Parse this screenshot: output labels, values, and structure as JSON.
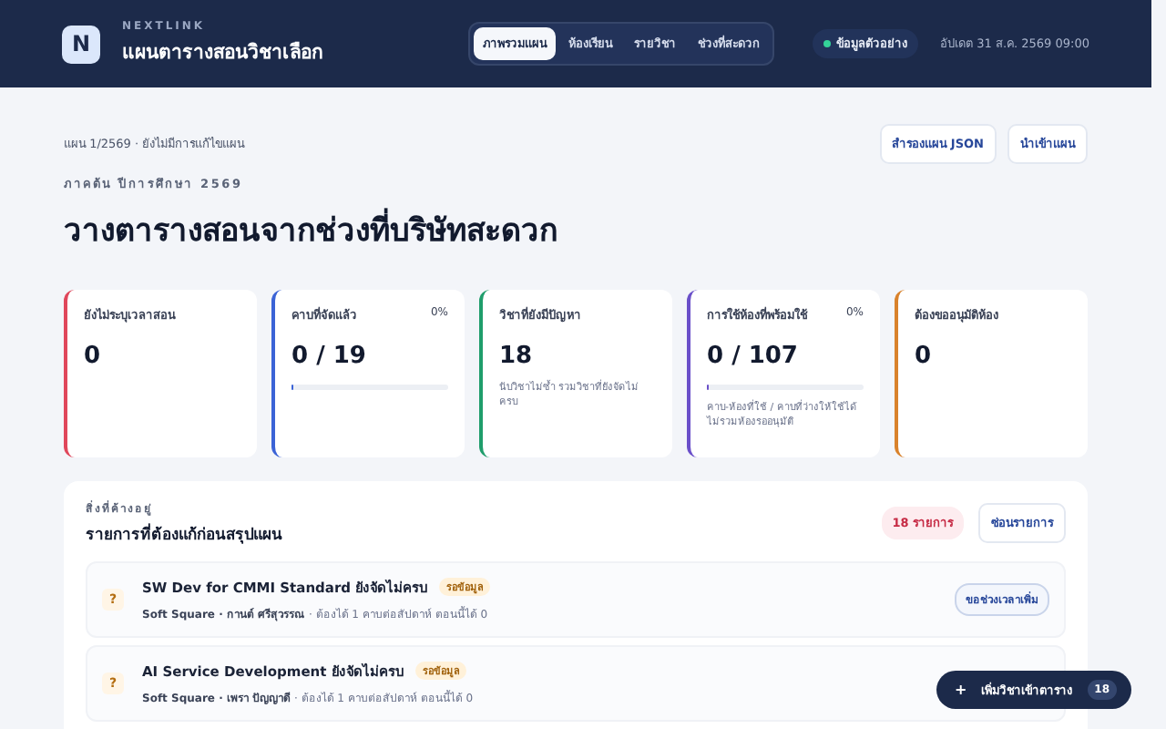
{
  "header": {
    "logo": "N",
    "brand": "NEXTLINK",
    "title": "แผนตารางสอนวิชาเลือก",
    "tabs": [
      {
        "label": "ภาพรวมแผน",
        "selected": true
      },
      {
        "label": "ห้องเรียน",
        "selected": false
      },
      {
        "label": "รายวิชา",
        "selected": false
      },
      {
        "label": "ช่วงที่สะดวก",
        "selected": false
      }
    ],
    "status": {
      "label": "ข้อมูลตัวอย่าง",
      "color": "#34d399"
    },
    "updated": "อัปเดต 31 ส.ค. 2569 09:00"
  },
  "plan_status": "แผน 1/2569 · ยังไม่มีการแก้ไขแผน",
  "actions": [
    "สำรองแผน JSON",
    "นำเข้าแผน"
  ],
  "eyebrow": "ภาคต้น ปีการศึกษา 2569",
  "heading": "วางตารางสอนจากช่วงที่บริษัทสะดวก",
  "cards": [
    {
      "label": "ยังไม่ระบุเวลาสอน",
      "value": "0",
      "color": "#e0475b"
    },
    {
      "label": "คาบที่จัดแล้ว",
      "value": "0 / 19",
      "percent": "0%",
      "level": 0.01,
      "color": "#3b63d6"
    },
    {
      "label": "วิชาที่ยังมีปัญหา",
      "value": "18",
      "note": "นับวิชาไม่ซ้ำ รวมวิชาที่ยังจัดไม่ครบ",
      "color": "#1f9d6b"
    },
    {
      "label": "การใช้ห้องที่พร้อมใช้",
      "value": "0 / 107",
      "percent": "0%",
      "level": 0.01,
      "note": "คาบ-ห้องที่ใช้ / คาบที่ว่างให้ใช้ได้ ไม่รวมห้องรออนุมัติ",
      "color": "#6a4fc9"
    },
    {
      "label": "ต้องขออนุมัติห้อง",
      "value": "0",
      "color": "#d9822b"
    }
  ],
  "pending": {
    "eyebrow": "สิ่งที่ค้างอยู่",
    "title": "รายการที่ต้องแก้ก่อนสรุปแผน",
    "count": "18 รายการ",
    "toggle": "ซ่อนรายการ",
    "items": [
      {
        "icon": "?",
        "title": "SW Dev for CMMI Standard ยังจัดไม่ครบ",
        "tag": "รอข้อมูล",
        "detail": "**Soft Square · กานต์ ศรีสุวรรณ** · ต้องได้ 1 คาบต่อสัปดาห์ ตอนนี้ได้ 0",
        "action": "ขอช่วงเวลาเพิ่ม"
      },
      {
        "icon": "?",
        "title": "AI Service Development ยังจัดไม่ครบ",
        "tag": "รอข้อมูล",
        "detail": "**Soft Square · เพรา ปัญญาดี** · ต้องได้ 1 คาบต่อสัปดาห์ ตอนนี้ได้ 0"
      }
    ]
  },
  "fab": {
    "icon": "+",
    "label": "เพิ่มวิชาเข้าตาราง",
    "count": "18"
  }
}
